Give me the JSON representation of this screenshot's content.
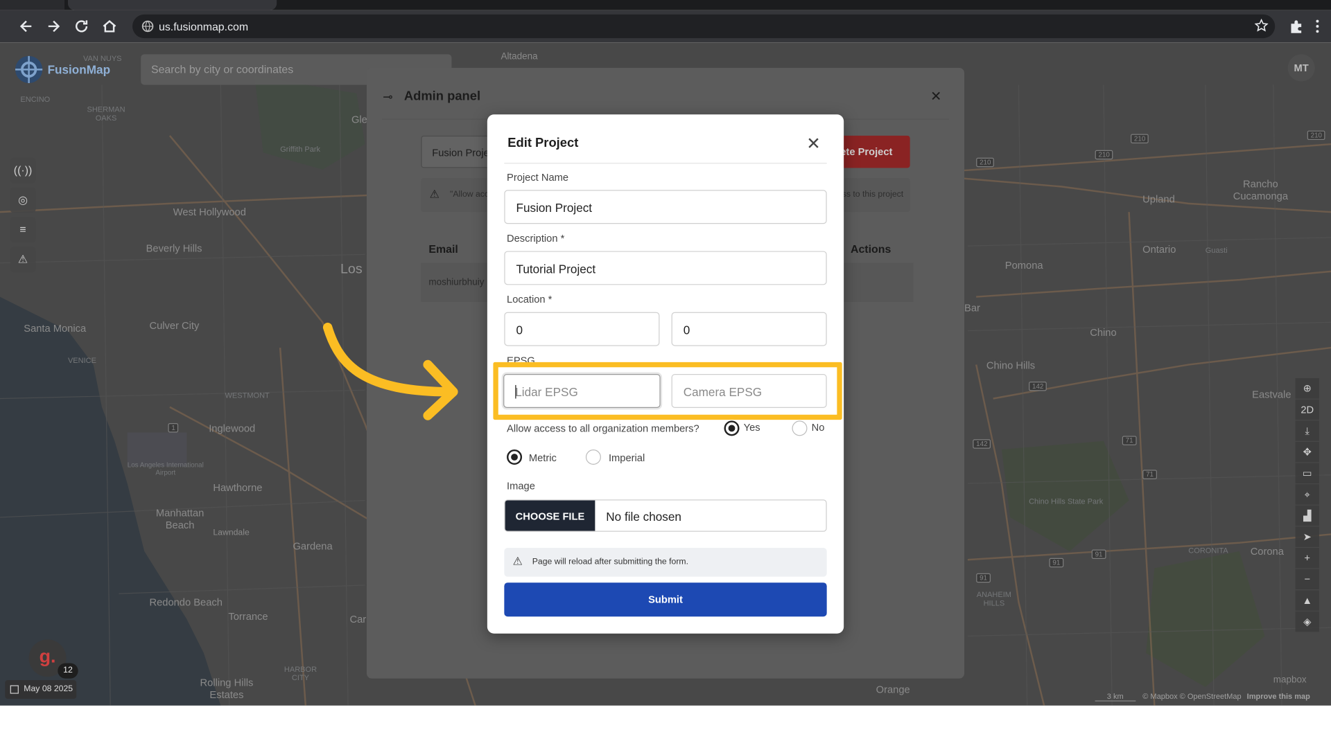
{
  "browser": {
    "url": "us.fusionmap.com",
    "nav_icons": [
      "back-icon",
      "forward-icon",
      "reload-icon",
      "home-icon"
    ],
    "right_icons": [
      "star-icon",
      "extensions-icon",
      "menu-icon"
    ]
  },
  "map": {
    "app_name": "FusionMap",
    "search_placeholder": "Search by city or coordinates",
    "avatar_initials": "MT",
    "left_tools": [
      "antenna-icon",
      "camera-icon",
      "list-icon",
      "warning-icon"
    ],
    "right_tools": [
      "add-icon",
      "2D",
      "download-icon",
      "move-icon",
      "ruler-icon",
      "pin-icon",
      "chart-icon",
      "locate-icon",
      "zoom-in-icon",
      "zoom-out-icon",
      "compass-icon",
      "layers-icon"
    ],
    "two_d_label": "2D",
    "g_letter": "g.",
    "g_count": "12",
    "date": "May 08 2025",
    "attribution": "© Mapbox © OpenStreetMap",
    "improve": "Improve this map",
    "scale": "3 km",
    "mapbox": "mapbox",
    "places": {
      "santa_monica": "Santa Monica",
      "culver_city": "Culver City",
      "west_hollywood": "West Hollywood",
      "beverly_hills": "Beverly Hills",
      "inglewood": "Inglewood",
      "hawthorne": "Hawthorne",
      "manhattan_beach": "Manhattan Beach",
      "gardena": "Gardena",
      "redondo_beach": "Redondo Beach",
      "torrance": "Torrance",
      "rolling_hills": "Rolling Hills Estates",
      "los": "Los",
      "car": "Car",
      "upland": "Upland",
      "rancho": "Rancho Cucamonga",
      "ontario": "Ontario",
      "pomona": "Pomona",
      "chino": "Chino",
      "chino_hills": "Chino Hills",
      "eastvale": "Eastvale",
      "corona": "Corona",
      "orange": "Orange",
      "altadena": "Altadena",
      "bar": "Bar",
      "encino": "ENCINO",
      "venice": "VENICE",
      "westmont": "WESTMONT",
      "lawndale": "Lawndale",
      "sherman_oaks": "SHERMAN OAKS",
      "van_nuys": "VAN NUYS",
      "lax": "Los Angeles International Airport",
      "harbor_city": "HARBOR CITY",
      "griffith": "Griffith Park",
      "chino_hills_sp": "Chino Hills State Park",
      "gle": "Gle",
      "anaheim_hills": "ANAHEIM HILLS",
      "coronita": "CORONITA",
      "guasti": "Guasti"
    }
  },
  "admin_panel": {
    "title": "Admin panel",
    "project_input_value": "Fusion Proje",
    "delete_label": "elete Project",
    "notice_left": "\"Allow acc",
    "notice_right": "ss to this project",
    "col_email": "Email",
    "col_actions": "Actions",
    "row_email": "moshiurbhuiy"
  },
  "modal": {
    "title": "Edit Project",
    "project_name_label": "Project Name",
    "project_name_value": "Fusion Project",
    "description_label": "Description *",
    "description_value": "Tutorial Project",
    "location_label": "Location *",
    "location_lat": "0",
    "location_lng": "0",
    "epsg_label": "EPSG",
    "lidar_placeholder": "Lidar EPSG",
    "camera_placeholder": "Camera EPSG",
    "access_question": "Allow access to all organization members?",
    "access_yes": "Yes",
    "access_no": "No",
    "access_selected": "Yes",
    "units_metric": "Metric",
    "units_imperial": "Imperial",
    "units_selected": "Metric",
    "image_label": "Image",
    "choose_file_label": "CHOOSE FILE",
    "no_file_text": "No file chosen",
    "notice": "Page will reload after submitting the form.",
    "submit_label": "Submit"
  },
  "colors": {
    "highlight": "#fbbd23",
    "submit": "#1d49b3",
    "delete": "#d43b3b",
    "file_button": "#1f2633"
  }
}
